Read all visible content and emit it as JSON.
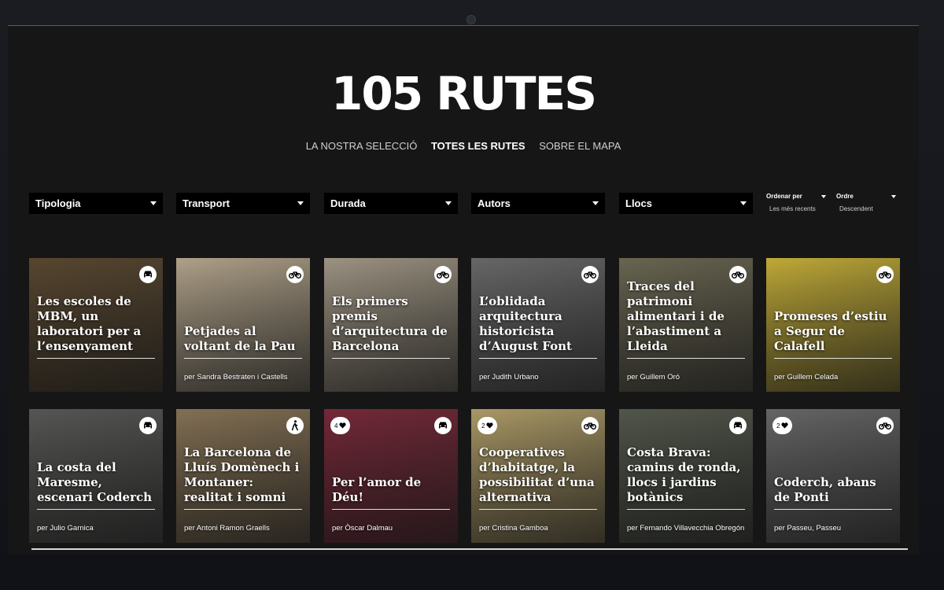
{
  "header": {
    "title": "105 RUTES",
    "nav": [
      {
        "label": "LA NOSTRA SELECCIÓ",
        "active": false
      },
      {
        "label": "TOTES LES RUTES",
        "active": true
      },
      {
        "label": "SOBRE EL MAPA",
        "active": false
      }
    ]
  },
  "filters": [
    {
      "label": "Tipologia"
    },
    {
      "label": "Transport"
    },
    {
      "label": "Durada"
    },
    {
      "label": "Autors"
    },
    {
      "label": "Llocs"
    }
  ],
  "sort": {
    "order_by_label": "Ordenar per",
    "order_by_value": "Les més recents",
    "order_label": "Ordre",
    "order_value": "Descendent"
  },
  "cards": [
    {
      "title": "Les escoles de MBM, un laboratori per a l’ensenyament",
      "author": "",
      "mode_icon": "car-icon",
      "likes": "",
      "bg": "#5c4a32"
    },
    {
      "title": "Petjades al voltant de la Pau",
      "author": "per Sandra Bestraten i Castells",
      "mode_icon": "bicycle-icon",
      "likes": "",
      "bg": "#b8a990"
    },
    {
      "title": "Els primers premis d’arquitectura de Barcelona",
      "author": "",
      "mode_icon": "bicycle-icon",
      "likes": "",
      "bg": "#a49a88"
    },
    {
      "title": "L’oblidada arquitectura historicista d’August Font",
      "author": "per Judith Urbano",
      "mode_icon": "bicycle-icon",
      "likes": "",
      "bg": "#6c6c6c"
    },
    {
      "title": "Traces del patrimoni alimentari i de l’abastiment a Lleida",
      "author": "per Guillem Oró",
      "mode_icon": "bicycle-icon",
      "likes": "",
      "bg": "#6e6a55"
    },
    {
      "title": "Promeses d’estiu a Segur de Calafell",
      "author": "per Guillem Celada",
      "mode_icon": "bicycle-icon",
      "likes": "",
      "bg": "#c9b23a"
    },
    {
      "title": "La costa del Maresme, escenari Coderch",
      "author": "per Julio Garnica",
      "mode_icon": "car-icon",
      "likes": "",
      "bg": "#5a5a58"
    },
    {
      "title": "La Barcelona de Lluís Domènech i Montaner: realitat i somni",
      "author": "per Antoni Ramon Graells",
      "mode_icon": "walk-icon",
      "likes": "",
      "bg": "#8a7658"
    },
    {
      "title": "Per l’amor de Déu!",
      "author": "per Òscar Dalmau",
      "mode_icon": "car-icon",
      "likes": "4",
      "bg": "#7a2a3a"
    },
    {
      "title": "Cooperatives d’habitatge, la possibilitat d’una alternativa",
      "author": "per Cristina Gamboa",
      "mode_icon": "bicycle-icon",
      "likes": "2",
      "bg": "#b3a06a"
    },
    {
      "title": "Costa Brava: camins de ronda, llocs i jardins botànics",
      "author": "per Fernando Villavecchia Obregón",
      "mode_icon": "car-icon",
      "likes": "",
      "bg": "#555a4e"
    },
    {
      "title": "Coderch, abans de Ponti",
      "author": "per Passeu, Passeu",
      "mode_icon": "bicycle-icon",
      "likes": "2",
      "bg": "#6a6a6a"
    }
  ]
}
